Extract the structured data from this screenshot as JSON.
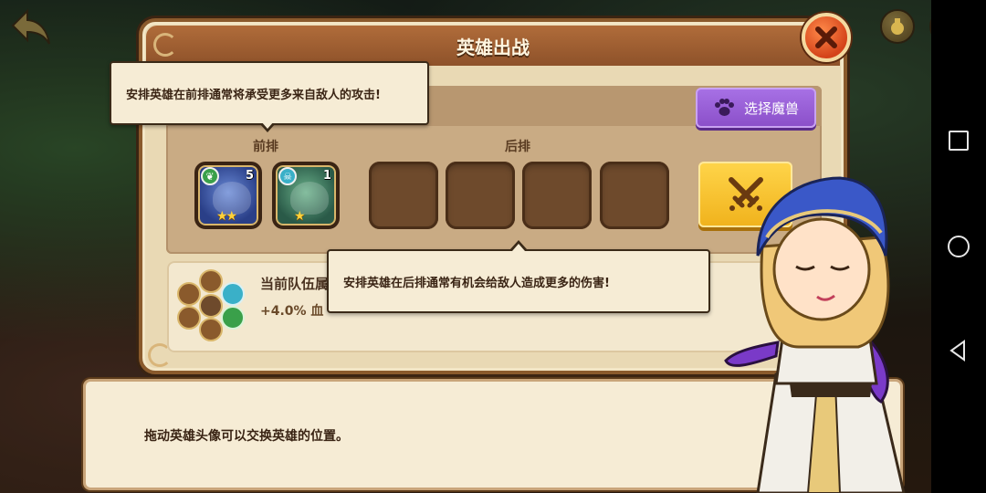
{
  "panel": {
    "title": "英雄出战",
    "front_row_label": "前排",
    "back_row_label": "后排",
    "select_beast_label": "选择魔兽"
  },
  "heroes": [
    {
      "element": "nature",
      "level": "5",
      "stars": "★★"
    },
    {
      "element": "skull",
      "level": "1",
      "stars": "★"
    }
  ],
  "empty_back_slots": 4,
  "team": {
    "title": "当前队伍属",
    "bonus": "+4.0%  血"
  },
  "tooltips": {
    "front": "安排英雄在前排通常将承受更多来自敌人的攻击!",
    "back": "安排英雄在后排通常有机会给敌人造成更多的伤害!"
  },
  "dialog": {
    "text": "拖动英雄头像可以交换英雄的位置。"
  },
  "icons": {
    "back": "back-arrow-icon",
    "bag": "bag-icon",
    "help": "help-icon",
    "close": "close-icon",
    "battle": "crossed-swords-icon",
    "paw": "paw-icon"
  },
  "top_icons": {
    "help_glyph": "?"
  },
  "colors": {
    "panel_bg": "#e9d9b4",
    "header": "#8e522a",
    "select_beast": "#8a4ec8",
    "battle": "#f0b21c",
    "close": "#d4431a"
  }
}
